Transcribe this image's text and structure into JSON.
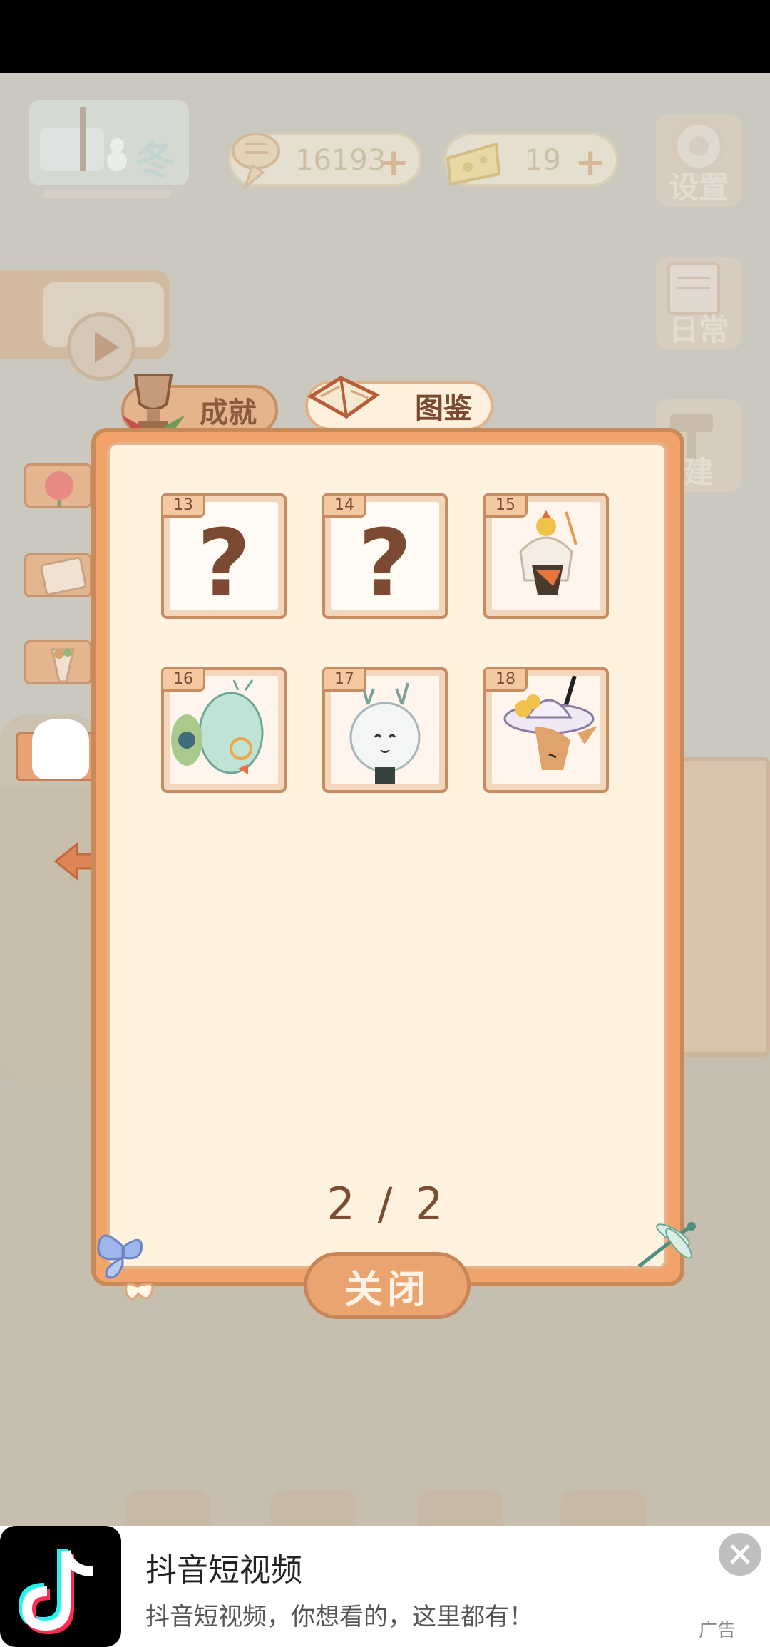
{
  "hud": {
    "season_label": "冬",
    "fish_count": "16193",
    "cheese_count": "19",
    "settings_label": "设置",
    "daily_label": "日常",
    "build_label": "建"
  },
  "modal": {
    "tabs": [
      {
        "label": "成就",
        "active": false
      },
      {
        "label": "图鉴",
        "active": true
      }
    ],
    "cards": [
      {
        "number": "13",
        "unlocked": false,
        "glyph": "?"
      },
      {
        "number": "14",
        "unlocked": false,
        "glyph": "?"
      },
      {
        "number": "15",
        "unlocked": true
      },
      {
        "number": "16",
        "unlocked": true
      },
      {
        "number": "17",
        "unlocked": true
      },
      {
        "number": "18",
        "unlocked": true
      }
    ],
    "page_indicator": "2 / 2",
    "close_label": "关闭"
  },
  "ad": {
    "title": "抖音短视频",
    "subtitle": "抖音短视频，你想看的，这里都有！",
    "tag": "广告"
  },
  "colors": {
    "accent": "#f0a46c",
    "panel": "#fff3df",
    "text_brown": "#7c4a33"
  }
}
